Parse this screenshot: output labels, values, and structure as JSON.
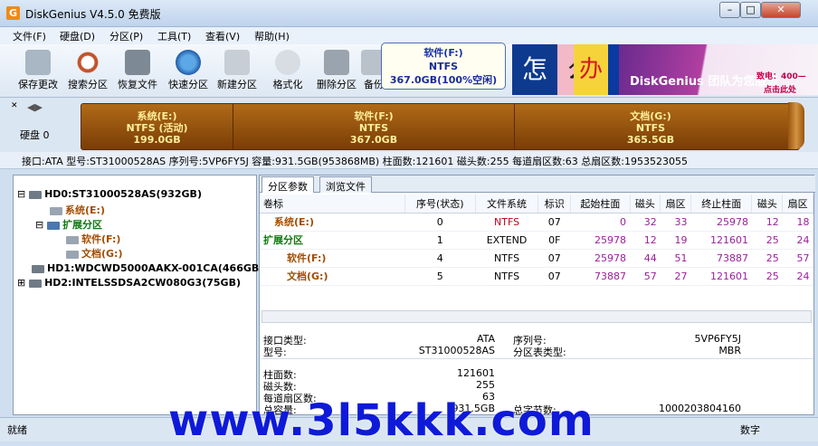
{
  "window": {
    "title": "DiskGenius V4.5.0 免费版"
  },
  "menu": [
    "文件(F)",
    "硬盘(D)",
    "分区(P)",
    "工具(T)",
    "查看(V)",
    "帮助(H)"
  ],
  "toolbar": [
    "保存更改",
    "搜索分区",
    "恢复文件",
    "快速分区",
    "新建分区",
    "格式化",
    "删除分区",
    "备份"
  ],
  "tooltip": {
    "title": "软件(F:)",
    "fs": "NTFS",
    "size": "367.0GB(100%空闲)"
  },
  "banner": {
    "chars": [
      "怎",
      "么",
      "办"
    ],
    "text": "DiskGenius 团队为您服务",
    "sub": "致电：400—",
    "sub2": "点击此处"
  },
  "diskmap": {
    "label": "硬盘 0",
    "partitions": [
      {
        "name": "系统(E:)",
        "fs": "NTFS (活动)",
        "size": "199.0GB"
      },
      {
        "name": "软件(F:)",
        "fs": "NTFS",
        "size": "367.0GB"
      },
      {
        "name": "文档(G:)",
        "fs": "NTFS",
        "size": "365.5GB"
      }
    ]
  },
  "infobar": "接口:ATA  型号:ST31000528AS  序列号:5VP6FY5J  容量:931.5GB(953868MB)  柱面数:121601  磁头数:255  每道扇区数:63  总扇区数:1953523055",
  "tree": {
    "disk0": "HD0:ST31000528AS(932GB)",
    "p1": "系统(E:)",
    "ext": "扩展分区",
    "p2": "软件(F:)",
    "p3": "文档(G:)",
    "disk1": "HD1:WDCWD5000AAKX-001CA(466GB)",
    "disk2": "HD2:INTELSSDSA2CW080G3(75GB)"
  },
  "tabs": [
    "分区参数",
    "浏览文件"
  ],
  "columns": [
    "卷标",
    "序号(状态)",
    "文件系统",
    "标识",
    "起始柱面",
    "磁头",
    "扇区",
    "终止柱面",
    "磁头",
    "扇区"
  ],
  "rows": [
    {
      "name": "系统(E:)",
      "no": "0",
      "fs": "NTFS",
      "id": "07",
      "sc": "0",
      "sh": "32",
      "ss": "33",
      "ec": "25978",
      "eh": "12",
      "es": "18"
    },
    {
      "name": "扩展分区",
      "no": "1",
      "fs": "EXTEND",
      "id": "0F",
      "sc": "25978",
      "sh": "12",
      "ss": "19",
      "ec": "121601",
      "eh": "25",
      "es": "24"
    },
    {
      "name": "软件(F:)",
      "no": "4",
      "fs": "NTFS",
      "id": "07",
      "sc": "25978",
      "sh": "44",
      "ss": "51",
      "ec": "73887",
      "eh": "25",
      "es": "57"
    },
    {
      "name": "文档(G:)",
      "no": "5",
      "fs": "NTFS",
      "id": "07",
      "sc": "73887",
      "sh": "57",
      "ss": "27",
      "ec": "121601",
      "eh": "25",
      "es": "24"
    }
  ],
  "detail": {
    "k_iface": "接口类型:",
    "v_iface": "ATA",
    "k_model": "型号:",
    "v_model": "ST31000528AS",
    "k_serial": "序列号:",
    "v_serial": "5VP6FY5J",
    "k_ptype": "分区表类型:",
    "v_ptype": "MBR",
    "k_cyl": "柱面数:",
    "v_cyl": "121601",
    "k_heads": "磁头数:",
    "v_heads": "255",
    "k_spt": "每道扇区数:",
    "v_spt": "63",
    "k_cap": "总容量:",
    "v_cap": "931.5GB",
    "k_bytes": "总字节数:",
    "v_bytes": "1000203804160"
  },
  "status": {
    "text": "就绪",
    "num": "数字"
  },
  "watermark": "www.3l5kkk.com"
}
